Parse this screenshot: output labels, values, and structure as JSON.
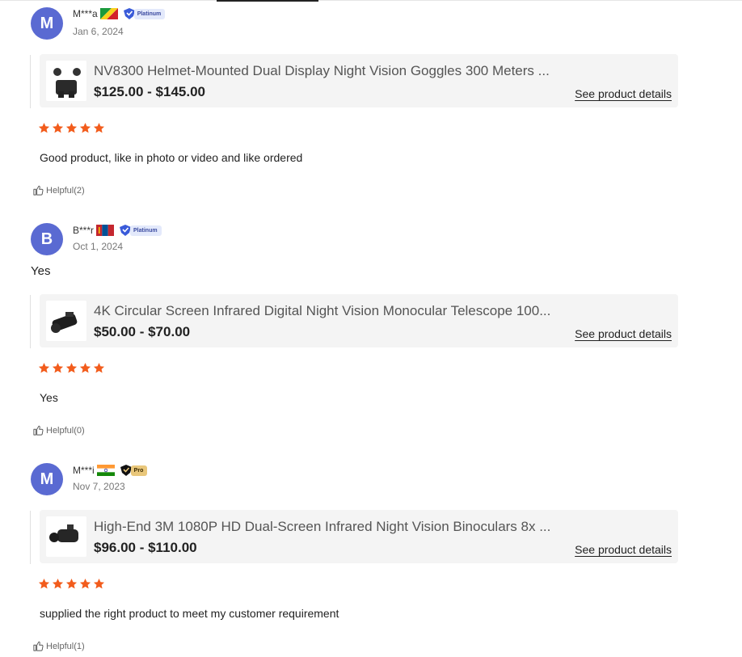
{
  "reviews": [
    {
      "avatar_letter": "M",
      "username": "M***a",
      "flag": "congo-flag",
      "badge": "Platinum",
      "date": "Jan 6, 2024",
      "extra_text": "",
      "product": {
        "title": "NV8300 Helmet-Mounted Dual Display Night Vision Goggles 300 Meters ...",
        "price": "$125.00 - $145.00",
        "details_label": "See product details"
      },
      "stars": 5,
      "comment": "Good product, like in photo or video and like ordered",
      "helpful": "Helpful(2)"
    },
    {
      "avatar_letter": "B",
      "username": "B***r",
      "flag": "mongolia-flag",
      "badge": "Platinum",
      "date": "Oct 1, 2024",
      "extra_text": "Yes",
      "product": {
        "title": "4K Circular Screen Infrared Digital Night Vision Monocular Telescope 100...",
        "price": "$50.00 - $70.00",
        "details_label": "See product details"
      },
      "stars": 5,
      "comment": "Yes",
      "helpful": "Helpful(0)"
    },
    {
      "avatar_letter": "M",
      "username": "M***i",
      "flag": "india-flag",
      "badge": "Pro",
      "date": "Nov 7, 2023",
      "extra_text": "",
      "product": {
        "title": "High-End 3M 1080P HD Dual-Screen Infrared Night Vision Binoculars 8x ...",
        "price": "$96.00 - $110.00",
        "details_label": "See product details"
      },
      "stars": 5,
      "comment": "supplied the right product to meet my customer requirement",
      "helpful": "Helpful(1)"
    }
  ],
  "colors": {
    "avatar": "#5a6ad2",
    "star": "#f25c1c",
    "platinum_badge": "#3a5bd9",
    "pro_badge": "#e9c77b"
  }
}
